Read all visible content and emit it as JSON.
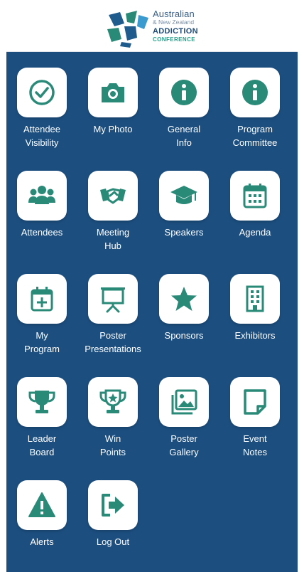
{
  "header": {
    "logo": {
      "line1": "Australian",
      "line2": "& New Zealand",
      "line3": "ADDICTION",
      "line4": "CONFERENCE"
    }
  },
  "colors": {
    "background": "#1c4f80",
    "icon": "#2a8a78",
    "tile": "#ffffff",
    "label": "#ffffff"
  },
  "tiles": [
    {
      "label": "Attendee\nVisibility",
      "icon": "check-circle-icon"
    },
    {
      "label": "My Photo",
      "icon": "camera-icon"
    },
    {
      "label": "General\nInfo",
      "icon": "info-icon"
    },
    {
      "label": "Program\nCommittee",
      "icon": "info-icon"
    },
    {
      "label": "Attendees",
      "icon": "users-icon"
    },
    {
      "label": "Meeting\nHub",
      "icon": "handshake-icon"
    },
    {
      "label": "Speakers",
      "icon": "graduation-cap-icon"
    },
    {
      "label": "Agenda",
      "icon": "calendar-icon"
    },
    {
      "label": "My\nProgram",
      "icon": "calendar-plus-icon"
    },
    {
      "label": "Poster\nPresentations",
      "icon": "presentation-icon"
    },
    {
      "label": "Sponsors",
      "icon": "star-icon"
    },
    {
      "label": "Exhibitors",
      "icon": "building-icon"
    },
    {
      "label": "Leader\nBoard",
      "icon": "trophy-icon"
    },
    {
      "label": "Win\nPoints",
      "icon": "trophy-star-icon"
    },
    {
      "label": "Poster\nGallery",
      "icon": "images-icon"
    },
    {
      "label": "Event\nNotes",
      "icon": "note-icon"
    },
    {
      "label": "Alerts",
      "icon": "warning-icon"
    },
    {
      "label": "Log Out",
      "icon": "logout-icon"
    }
  ]
}
